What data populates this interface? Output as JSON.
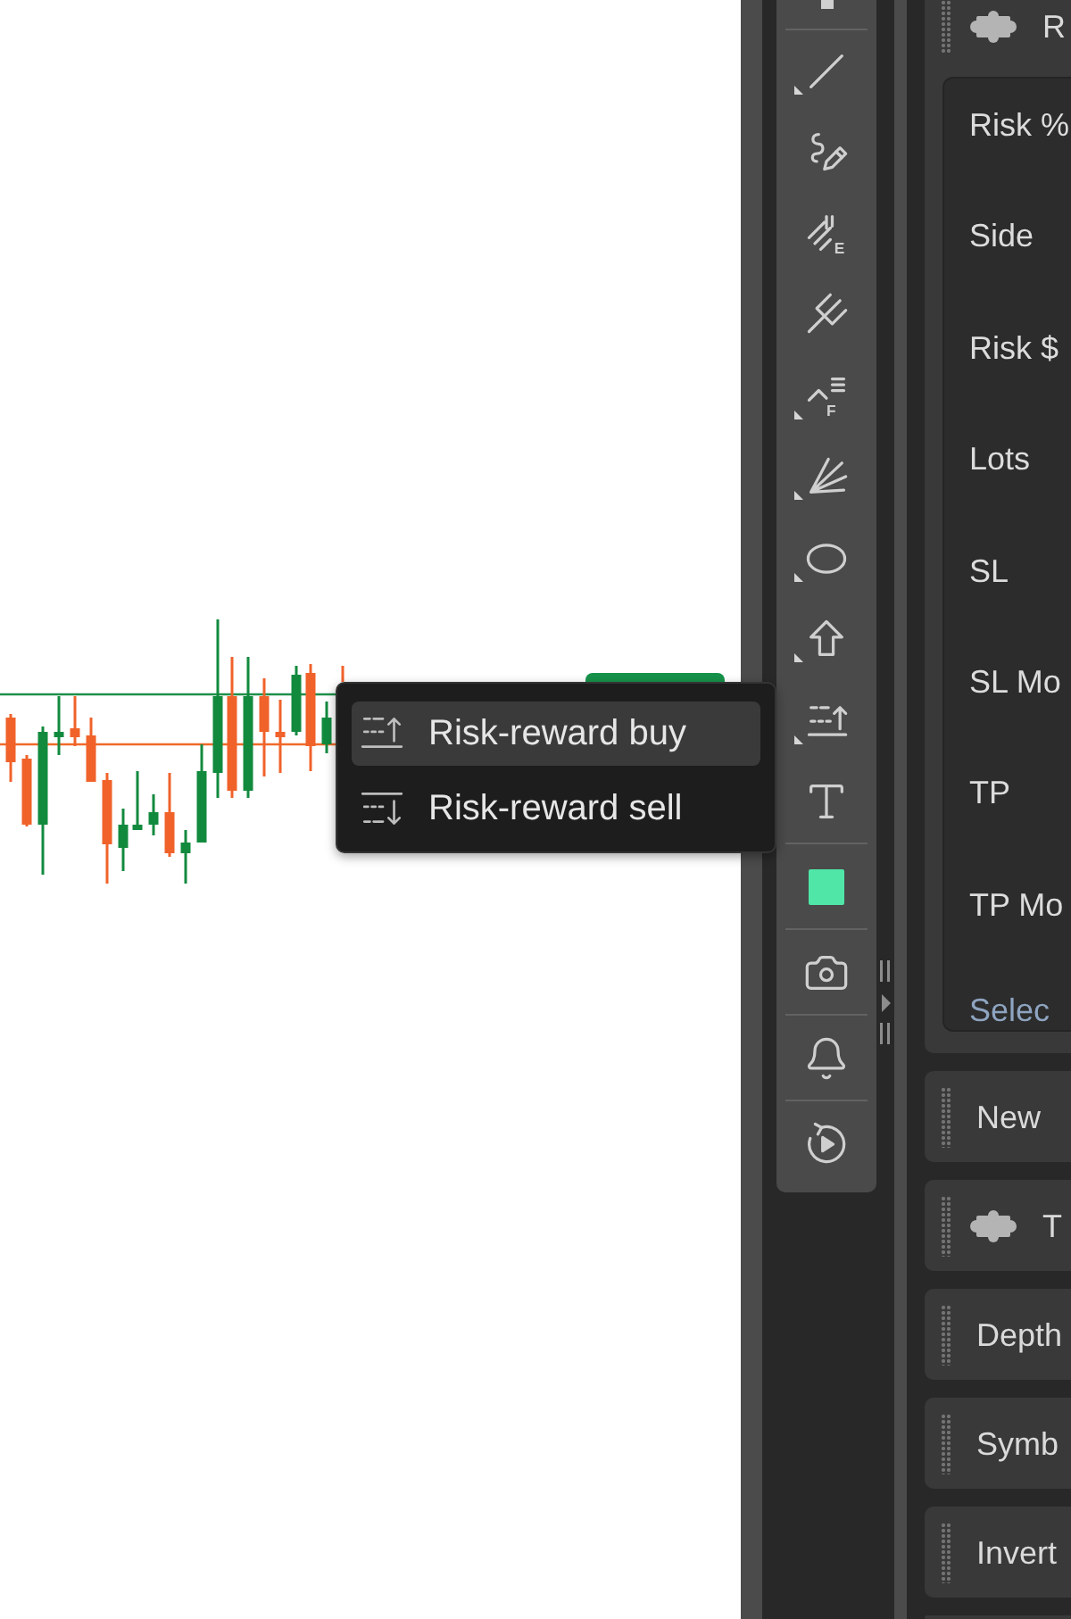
{
  "chart": {
    "popup_menu": {
      "items": [
        {
          "kind": "buy",
          "label": "Risk-reward buy",
          "highlighted": true
        },
        {
          "kind": "sell",
          "label": "Risk-reward sell",
          "highlighted": false
        }
      ]
    }
  },
  "toolbar": {
    "groups": [
      {
        "tools": [
          {
            "kind": "partial"
          }
        ]
      },
      {
        "tools": [
          {
            "kind": "line",
            "submenu": true
          },
          {
            "kind": "brush",
            "submenu": false
          },
          {
            "kind": "fibext",
            "letter": "E",
            "submenu": false
          },
          {
            "kind": "pitchfork",
            "submenu": false
          },
          {
            "kind": "fibret",
            "letter": "F",
            "submenu": true
          },
          {
            "kind": "fan",
            "submenu": true
          },
          {
            "kind": "ellipse",
            "submenu": true
          },
          {
            "kind": "arrow",
            "submenu": true
          },
          {
            "kind": "riskreward",
            "submenu": true
          },
          {
            "kind": "text",
            "submenu": false
          }
        ]
      },
      {
        "tools": [
          {
            "kind": "swatch",
            "color": "#50e6a8"
          }
        ]
      },
      {
        "tools": [
          {
            "kind": "camera"
          }
        ]
      },
      {
        "tools": [
          {
            "kind": "bell"
          }
        ]
      },
      {
        "tools": [
          {
            "kind": "replay"
          }
        ]
      }
    ]
  },
  "panels": [
    {
      "kind": "plugin",
      "title": "R",
      "fields": [
        "Risk %",
        "Side",
        "Risk $",
        "Lots",
        "SL",
        "SL Mo",
        "TP",
        "TP Mo"
      ],
      "link": "Selec"
    },
    {
      "kind": "section",
      "title": "New"
    },
    {
      "kind": "plugin",
      "title": "T"
    },
    {
      "kind": "section",
      "title": "Depth"
    },
    {
      "kind": "section",
      "title": "Symb"
    },
    {
      "kind": "section",
      "title": "Invert"
    },
    {
      "kind": "section"
    }
  ]
}
